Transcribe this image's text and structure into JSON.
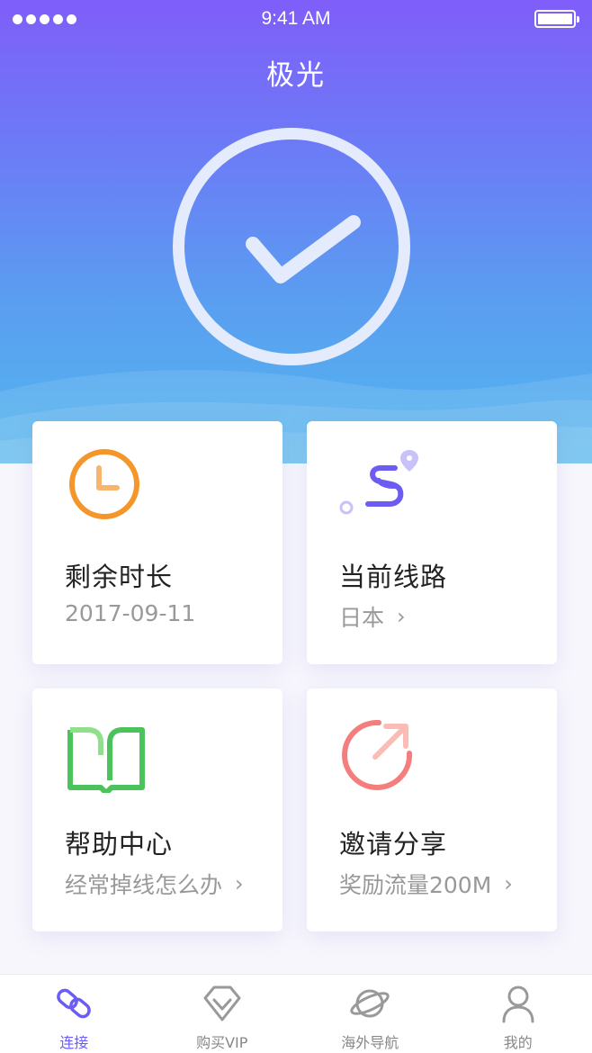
{
  "status_bar": {
    "time": "9:41 AM"
  },
  "header": {
    "title": "极光"
  },
  "connect": {
    "state_icon": "check-icon"
  },
  "cards": [
    {
      "title": "剩余时长",
      "subtitle": "2017-09-11",
      "icon": "clock-icon",
      "has_chevron": false
    },
    {
      "title": "当前线路",
      "subtitle": "日本",
      "icon": "route-icon",
      "has_chevron": true
    },
    {
      "title": "帮助中心",
      "subtitle": "经常掉线怎么办",
      "icon": "book-icon",
      "has_chevron": true
    },
    {
      "title": "邀请分享",
      "subtitle": "奖励流量200M",
      "icon": "share-icon",
      "has_chevron": true
    }
  ],
  "tabbar": {
    "items": [
      {
        "label": "连接",
        "icon": "link-icon",
        "active": true
      },
      {
        "label": "购买VIP",
        "icon": "diamond-icon",
        "active": false
      },
      {
        "label": "海外导航",
        "icon": "planet-icon",
        "active": false
      },
      {
        "label": "我的",
        "icon": "user-icon",
        "active": false
      }
    ]
  },
  "colors": {
    "accent": "#6a5cf5",
    "clock": "#f5962b",
    "route": "#6d5cf3",
    "book": "#4cc25a",
    "share": "#f47d7d"
  }
}
